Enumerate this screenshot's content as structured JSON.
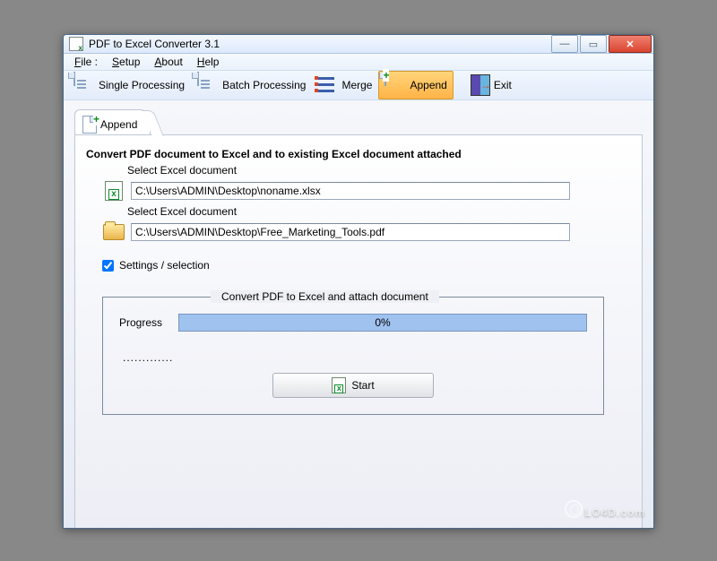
{
  "window": {
    "title": "PDF to Excel Converter  3.1"
  },
  "menubar": {
    "file": "File :",
    "setup": "Setup",
    "about": "About",
    "help": "Help"
  },
  "toolbar": {
    "single": "Single Processing",
    "batch": "Batch Processing",
    "merge": "Merge",
    "append": "Append",
    "exit": "Exit"
  },
  "tab": {
    "label": "Append"
  },
  "panel": {
    "heading": "Convert PDF document to Excel and to existing Excel document attached",
    "select_excel_label1": "Select Excel document",
    "excel_path": "C:\\Users\\ADMIN\\Desktop\\noname.xlsx",
    "select_excel_label2": "Select Excel document",
    "pdf_path": "C:\\Users\\ADMIN\\Desktop\\Free_Marketing_Tools.pdf",
    "settings_label": "Settings / selection",
    "settings_checked": true
  },
  "fieldset": {
    "legend": "Convert PDF to Excel and attach document",
    "progress_label": "Progress",
    "progress_value": "0%",
    "status_dots": ".............",
    "start_label": "Start"
  },
  "watermark": "LO4D.com"
}
